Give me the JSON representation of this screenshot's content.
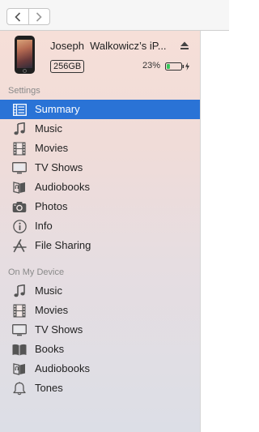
{
  "toolbar": {
    "back_icon": "chevron-left-icon",
    "forward_icon": "chevron-right-icon"
  },
  "device": {
    "name": "Joseph  Walkowicz’s iP...",
    "capacity": "256GB",
    "battery_percent": "23%",
    "battery_level": 0.23,
    "eject_icon": "eject-icon"
  },
  "settings": {
    "header": "Settings",
    "items": [
      {
        "label": "Summary",
        "icon": "summary-icon",
        "selected": true
      },
      {
        "label": "Music",
        "icon": "music-note-icon"
      },
      {
        "label": "Movies",
        "icon": "film-icon"
      },
      {
        "label": "TV Shows",
        "icon": "tv-icon"
      },
      {
        "label": "Audiobooks",
        "icon": "audiobook-icon"
      },
      {
        "label": "Photos",
        "icon": "camera-icon"
      },
      {
        "label": "Info",
        "icon": "info-icon"
      },
      {
        "label": "File Sharing",
        "icon": "app-store-icon"
      }
    ]
  },
  "on_device": {
    "header": "On My Device",
    "items": [
      {
        "label": "Music",
        "icon": "music-note-icon"
      },
      {
        "label": "Movies",
        "icon": "film-icon"
      },
      {
        "label": "TV Shows",
        "icon": "tv-icon"
      },
      {
        "label": "Books",
        "icon": "book-icon"
      },
      {
        "label": "Audiobooks",
        "icon": "audiobook-icon"
      },
      {
        "label": "Tones",
        "icon": "bell-icon"
      }
    ]
  },
  "colors": {
    "selection": "#2a73d6",
    "battery_fill": "#34c759"
  }
}
